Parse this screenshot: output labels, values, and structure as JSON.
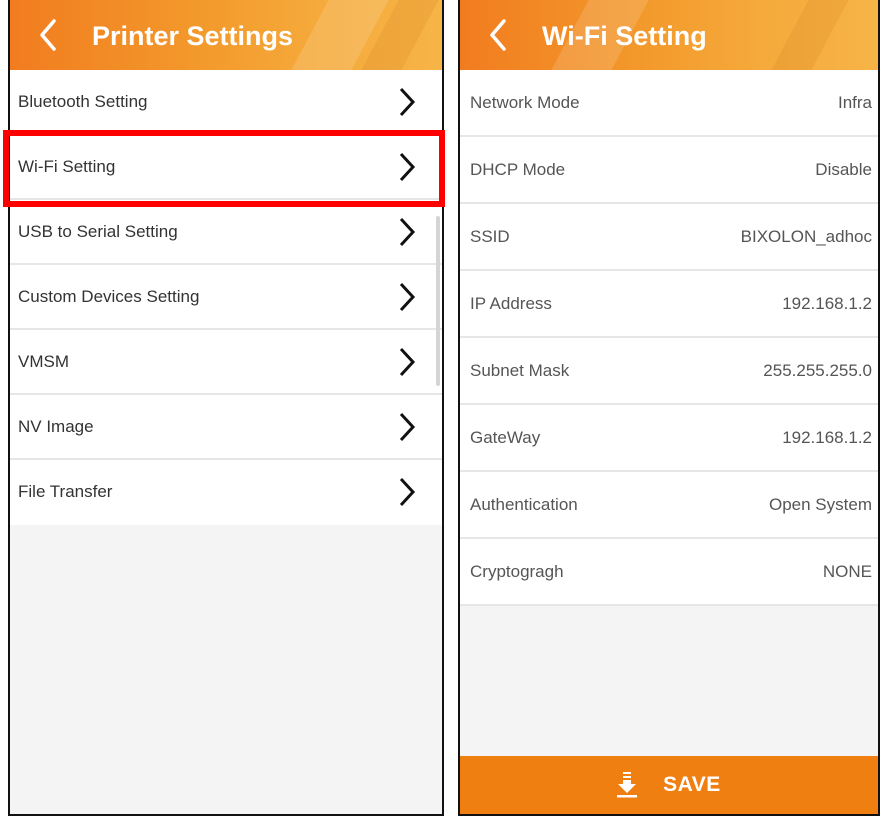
{
  "colors": {
    "header_start": "#f17c1f",
    "header_end": "#f6b447",
    "save_bar": "#f07f12",
    "highlight": "#ff0000",
    "background": "#f4f4f4"
  },
  "left": {
    "header": {
      "back_icon": "chevron-left-icon",
      "title": "Printer Settings"
    },
    "items": [
      {
        "label": "Bluetooth Setting",
        "icon": "chevron-right-icon"
      },
      {
        "label": "Wi-Fi Setting",
        "icon": "chevron-right-icon",
        "highlighted": true
      },
      {
        "label": "USB to Serial Setting",
        "icon": "chevron-right-icon"
      },
      {
        "label": "Custom Devices Setting",
        "icon": "chevron-right-icon"
      },
      {
        "label": "VMSM",
        "icon": "chevron-right-icon"
      },
      {
        "label": "NV Image",
        "icon": "chevron-right-icon"
      },
      {
        "label": "File Transfer",
        "icon": "chevron-right-icon"
      }
    ]
  },
  "right": {
    "header": {
      "back_icon": "chevron-left-icon",
      "title": "Wi-Fi Setting"
    },
    "settings": [
      {
        "label": "Network Mode",
        "value": "Infra"
      },
      {
        "label": "DHCP Mode",
        "value": "Disable"
      },
      {
        "label": "SSID",
        "value": "BIXOLON_adhoc"
      },
      {
        "label": "IP Address",
        "value": "192.168.1.2"
      },
      {
        "label": "Subnet Mask",
        "value": "255.255.255.0"
      },
      {
        "label": "GateWay",
        "value": "192.168.1.2"
      },
      {
        "label": "Authentication",
        "value": "Open System"
      },
      {
        "label": "Cryptogragh",
        "value": "NONE"
      }
    ],
    "save": {
      "icon": "download-icon",
      "label": "SAVE"
    }
  }
}
